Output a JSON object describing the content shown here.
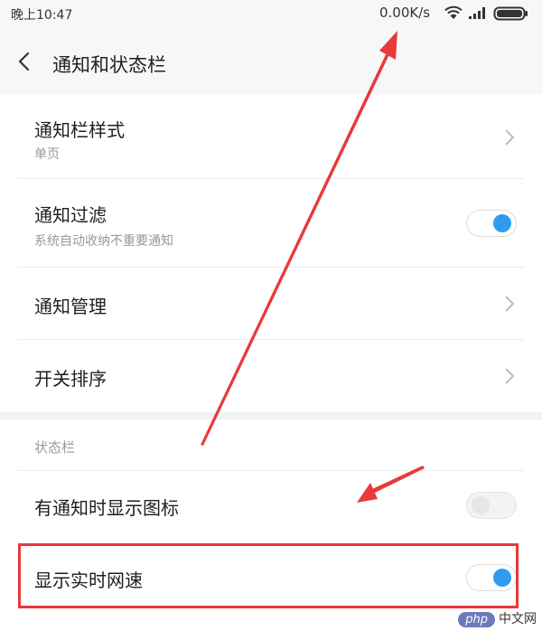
{
  "status_bar": {
    "time": "晚上10:47",
    "network_speed": "0.00K/s",
    "icons": [
      "wifi-icon",
      "signal-icon",
      "battery-icon"
    ]
  },
  "header": {
    "title": "通知和状态栏",
    "back_icon": "chevron-left-icon"
  },
  "notification_section": {
    "items": [
      {
        "title": "通知栏样式",
        "subtitle": "单页",
        "control": "chevron"
      },
      {
        "title": "通知过滤",
        "subtitle": "系统自动收纳不重要通知",
        "control": "toggle",
        "toggle_on": true
      },
      {
        "title": "通知管理",
        "control": "chevron"
      },
      {
        "title": "开关排序",
        "control": "chevron"
      }
    ]
  },
  "status_section": {
    "header": "状态栏",
    "items": [
      {
        "title": "有通知时显示图标",
        "control": "toggle",
        "toggle_on": false
      },
      {
        "title": "显示实时网速",
        "control": "toggle",
        "toggle_on": true,
        "highlighted": true
      }
    ]
  },
  "watermark": {
    "badge": "php",
    "text": "中文网"
  },
  "colors": {
    "accent": "#2f9bf0",
    "annotation": "#e8393a"
  }
}
